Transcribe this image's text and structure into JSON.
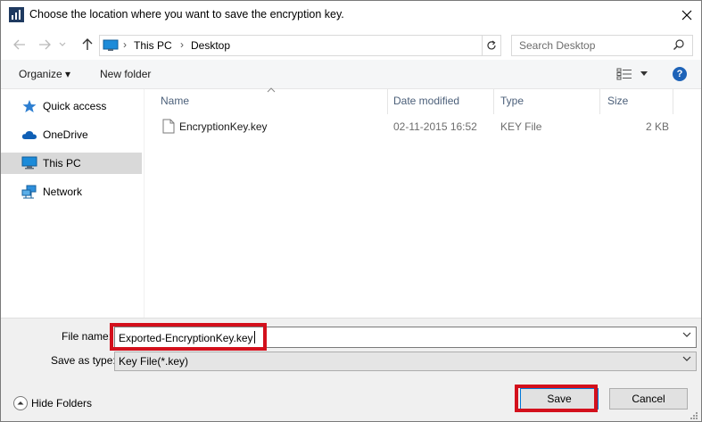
{
  "window": {
    "title": "Choose the location where you want to save the encryption key."
  },
  "address": {
    "crumbs": [
      "This PC",
      "Desktop"
    ],
    "search_placeholder": "Search Desktop"
  },
  "toolbar": {
    "organize_label": "Organize ▾",
    "new_folder_label": "New folder",
    "help_label": "?"
  },
  "nav": {
    "items": [
      {
        "label": "Quick access",
        "icon": "star-icon"
      },
      {
        "label": "OneDrive",
        "icon": "cloud-icon"
      },
      {
        "label": "This PC",
        "icon": "computer-icon",
        "selected": true
      },
      {
        "label": "Network",
        "icon": "network-icon"
      }
    ]
  },
  "files": {
    "columns": [
      "Name",
      "Date modified",
      "Type",
      "Size"
    ],
    "rows": [
      {
        "name": "EncryptionKey.key",
        "date": "02-11-2015 16:52",
        "type": "KEY File",
        "size": "2 KB"
      }
    ]
  },
  "save": {
    "filename_label": "File name:",
    "filename_value": "Exported-EncryptionKey.key",
    "type_label": "Save as type:",
    "type_value": "Key File(*.key)",
    "hide_folders_label": "Hide Folders",
    "save_label": "Save",
    "cancel_label": "Cancel"
  },
  "colors": {
    "highlight": "#d3101c",
    "accent": "#1e63b8"
  }
}
